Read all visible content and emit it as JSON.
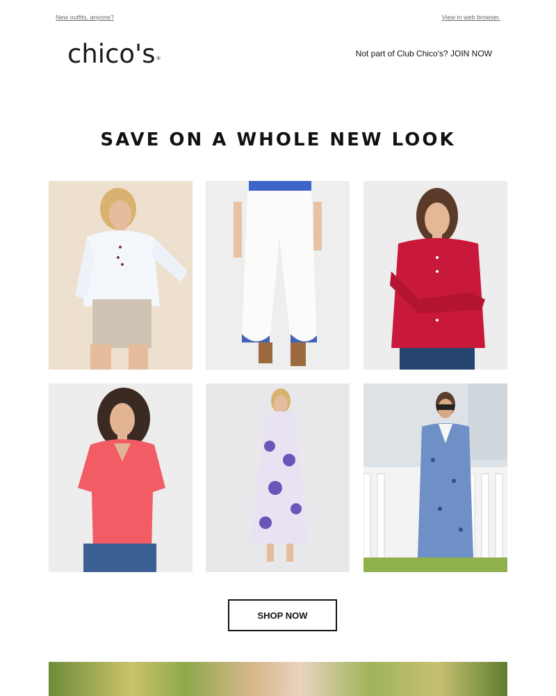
{
  "preheader": {
    "left_link": "New outfits, anyone?",
    "right_link": "View in web browser."
  },
  "header": {
    "logo_text": "chico's",
    "logo_mark": "®",
    "join_text": "Not part of Club Chico's? JOIN NOW"
  },
  "hero": {
    "headline": "SAVE ON A WHOLE NEW LOOK"
  },
  "products": [
    {
      "name": "white button-up shirt with khaki shorts"
    },
    {
      "name": "white embroidered wide-leg pants"
    },
    {
      "name": "red linen button-up shirt"
    },
    {
      "name": "coral v-neck tee"
    },
    {
      "name": "purple floral maxi dress"
    },
    {
      "name": "blue print shift dress"
    }
  ],
  "cta": {
    "label": "SHOP NOW"
  },
  "colors": {
    "accent": "#111111",
    "background": "#ffffff"
  }
}
